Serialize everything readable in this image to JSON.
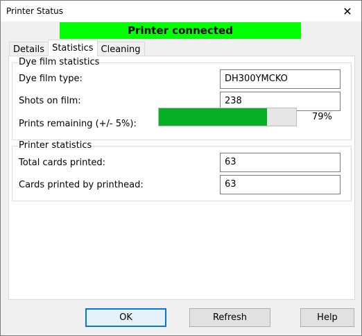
{
  "window": {
    "title": "Printer Status",
    "close_glyph": "✕"
  },
  "status": {
    "text": "Printer connected",
    "color": "#00ff00"
  },
  "tabs": [
    {
      "label": "Details",
      "active": false
    },
    {
      "label": "Statistics",
      "active": true
    },
    {
      "label": "Cleaning",
      "active": false
    }
  ],
  "dye_film": {
    "title": "Dye film statistics",
    "type_label": "Dye film type:",
    "type_value": "DH300YMCKO",
    "shots_label": "Shots on film:",
    "shots_value": "238",
    "remaining_label": "Prints remaining (+/- 5%):",
    "remaining_fraction": 0.79,
    "remaining_pct": "79%",
    "progress_color": "#06b025"
  },
  "printer_stats": {
    "title": "Printer statistics",
    "total_label": "Total cards printed:",
    "total_value": "63",
    "printhead_label": "Cards printed by printhead:",
    "printhead_value": "63"
  },
  "buttons": {
    "ok": "OK",
    "refresh": "Refresh",
    "help": "Help"
  }
}
